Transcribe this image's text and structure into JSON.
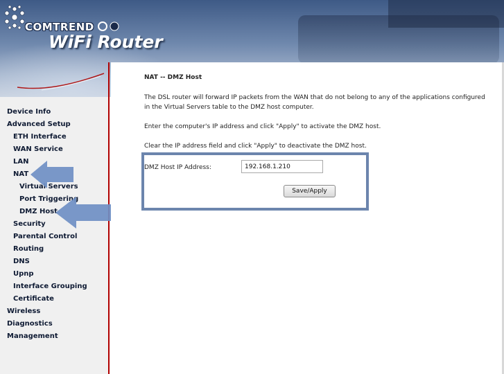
{
  "header": {
    "brand": "COMTREND",
    "product": "WiFi Router"
  },
  "sidebar": {
    "items": [
      {
        "label": "Device Info",
        "level": 0
      },
      {
        "label": "Advanced Setup",
        "level": 0
      },
      {
        "label": "ETH Interface",
        "level": 1
      },
      {
        "label": "WAN Service",
        "level": 1
      },
      {
        "label": "LAN",
        "level": 1
      },
      {
        "label": "NAT",
        "level": 1
      },
      {
        "label": "Virtual Servers",
        "level": 2
      },
      {
        "label": "Port Triggering",
        "level": 2
      },
      {
        "label": "DMZ Host",
        "level": 2
      },
      {
        "label": "Security",
        "level": 1
      },
      {
        "label": "Parental Control",
        "level": 1
      },
      {
        "label": "Routing",
        "level": 1
      },
      {
        "label": "DNS",
        "level": 1
      },
      {
        "label": "Upnp",
        "level": 1
      },
      {
        "label": "Interface Grouping",
        "level": 1
      },
      {
        "label": "Certificate",
        "level": 1
      },
      {
        "label": "Wireless",
        "level": 0
      },
      {
        "label": "Diagnostics",
        "level": 0
      },
      {
        "label": "Management",
        "level": 0
      }
    ]
  },
  "main": {
    "title": "NAT -- DMZ Host",
    "paragraphs": [
      "The DSL router will forward IP packets from the WAN that do not belong to any of the applications configured in the Virtual Servers table to the DMZ host computer.",
      "Enter the computer's IP address and click \"Apply\" to activate the DMZ host.",
      "Clear the IP address field and click \"Apply\" to deactivate the DMZ host."
    ],
    "ip_label": "DMZ Host IP Address:",
    "ip_value": "192.168.1.210",
    "save_label": "Save/Apply"
  },
  "colors": {
    "accent_arrow": "#6f8fc4",
    "highlight_border": "#6c85ad",
    "sidebar_divider": "#b00000"
  }
}
